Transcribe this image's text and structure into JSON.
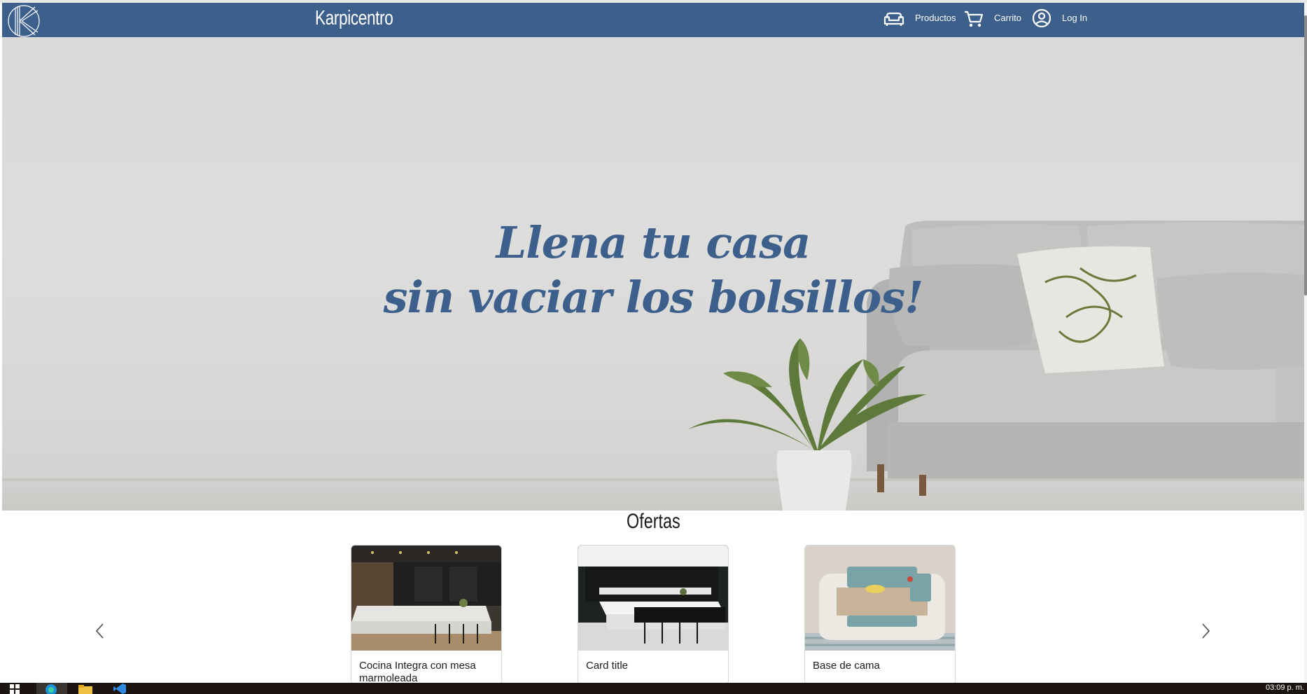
{
  "navbar": {
    "brand": "Karpicentro",
    "items": [
      {
        "label": "Productos",
        "icon": "sofa-icon"
      },
      {
        "label": "Carrito",
        "icon": "cart-icon"
      },
      {
        "label": "Log In",
        "icon": "user-circle-icon"
      }
    ]
  },
  "hero": {
    "line1": "Llena tu casa",
    "line2": "sin vaciar los bolsillos!"
  },
  "ofertas": {
    "title": "Ofertas",
    "cards": [
      {
        "title": "Cocina Integra con mesa marmoleada"
      },
      {
        "title": "Card title"
      },
      {
        "title": "Base de cama"
      }
    ]
  },
  "taskbar": {
    "clock": "03:09 p. m."
  },
  "colors": {
    "brand": "#3d5f8c",
    "navbar_text": "#ffffff"
  }
}
